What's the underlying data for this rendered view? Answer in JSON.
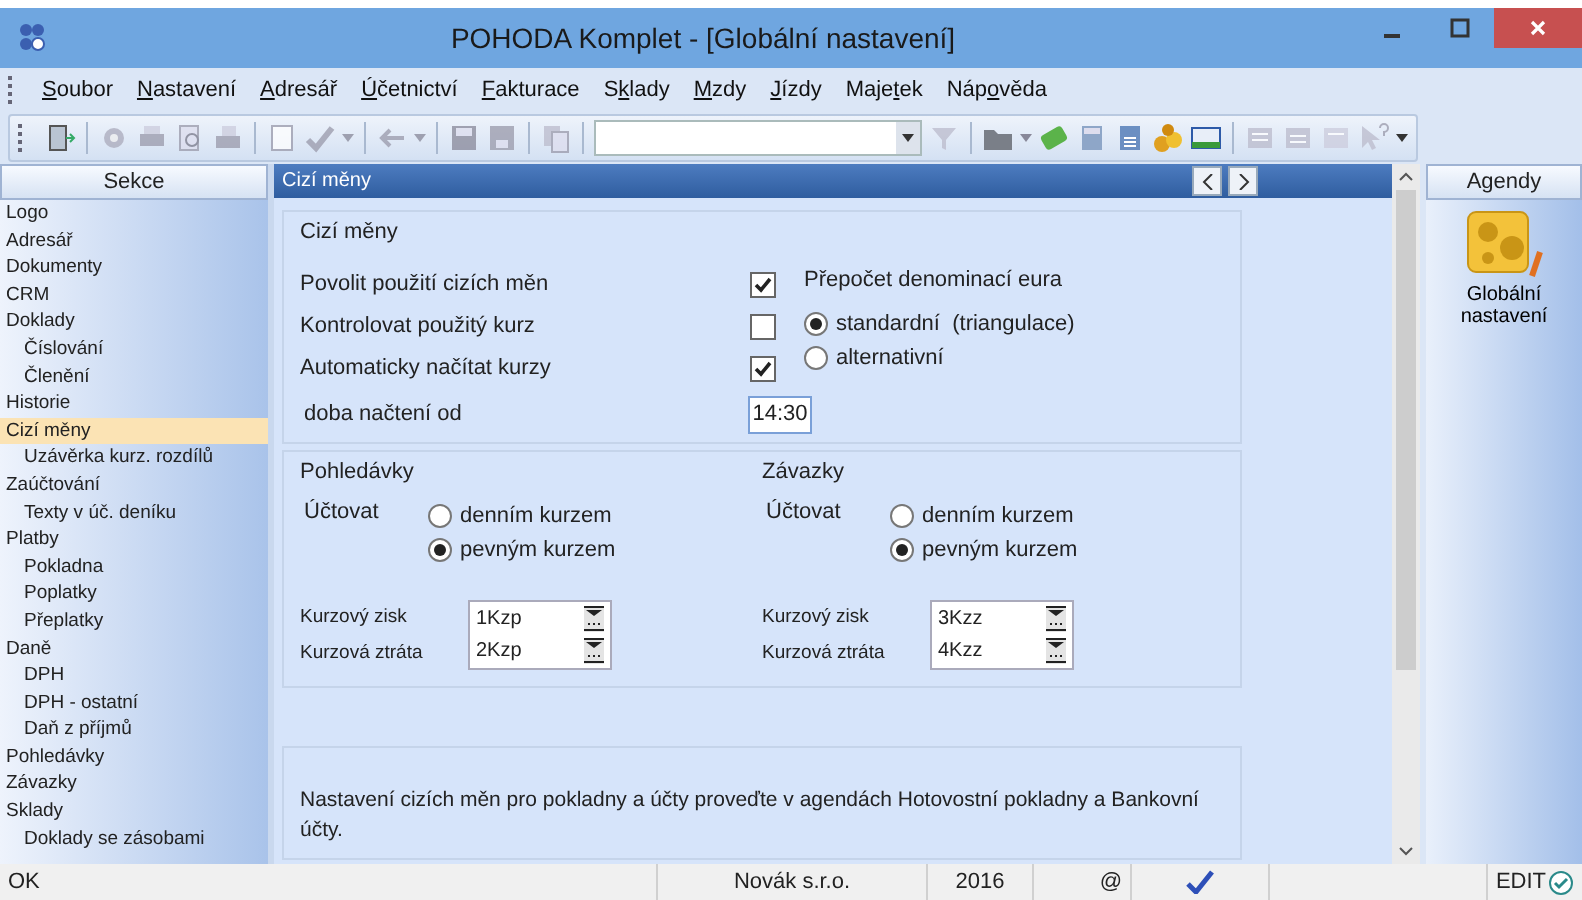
{
  "window": {
    "title": "POHODA Komplet - [Globální nastavení]"
  },
  "menu": [
    {
      "key": "S",
      "post": "oubor"
    },
    {
      "key": "N",
      "post": "astavení"
    },
    {
      "key": "A",
      "post": "dresář"
    },
    {
      "key": "Ú",
      "post": "četnictví"
    },
    {
      "key": "F",
      "post": "akturace"
    },
    {
      "pre": "S",
      "key": "k",
      "post": "lady"
    },
    {
      "key": "M",
      "post": "zdy"
    },
    {
      "key": "J",
      "post": "ízdy"
    },
    {
      "pre": "Maje",
      "key": "t",
      "post": "ek"
    },
    {
      "pre": "Náp",
      "key": "o",
      "post": "věda"
    }
  ],
  "sidebar": {
    "title": "Sekce",
    "items": [
      {
        "label": "Logo",
        "selected": false
      },
      {
        "label": "Adresář",
        "selected": false
      },
      {
        "label": "Dokumenty",
        "selected": false
      },
      {
        "label": "CRM",
        "selected": false
      },
      {
        "label": "Doklady",
        "selected": false,
        "children": [
          {
            "label": "Číslování",
            "selected": false
          },
          {
            "label": "Členění",
            "selected": false
          }
        ]
      },
      {
        "label": "Historie",
        "selected": false
      },
      {
        "label": "Cizí měny",
        "selected": true,
        "children": [
          {
            "label": "Uzávěrka kurz. rozdílů",
            "selected": false
          }
        ]
      },
      {
        "label": "Zaúčtování",
        "selected": false,
        "children": [
          {
            "label": "Texty v úč. deníku",
            "selected": false
          }
        ]
      },
      {
        "label": "Platby",
        "selected": false,
        "children": [
          {
            "label": "Pokladna",
            "selected": false
          },
          {
            "label": "Poplatky",
            "selected": false
          },
          {
            "label": "Přeplatky",
            "selected": false
          }
        ]
      },
      {
        "label": "Daně",
        "selected": false,
        "children": [
          {
            "label": "DPH",
            "selected": false
          },
          {
            "label": "DPH - ostatní",
            "selected": false
          },
          {
            "label": "Daň z příjmů",
            "selected": false
          }
        ]
      },
      {
        "label": "Pohledávky",
        "selected": false
      },
      {
        "label": "Závazky",
        "selected": false
      },
      {
        "label": "Sklady",
        "selected": false,
        "children": [
          {
            "label": "Doklady se zásobami",
            "selected": false
          }
        ]
      }
    ]
  },
  "panel": {
    "title": "Cizí měny",
    "group": {
      "title": "Cizí měny",
      "options": [
        {
          "label": "Povolit použití cizích měn",
          "checked": true
        },
        {
          "label": "Kontrolovat použitý kurz",
          "checked": false
        },
        {
          "label": "Automaticky načítat kurzy",
          "checked": true
        }
      ],
      "time": {
        "label": "doba načtení od",
        "value": "14:30"
      },
      "euro": {
        "title": "Přepočet denominací eura",
        "options": [
          {
            "label": "standardní  (triangulace)",
            "selected": true
          },
          {
            "label": "alternativní",
            "selected": false
          }
        ]
      }
    },
    "sections": [
      {
        "title": "Pohledávky",
        "label": "Účtovat",
        "options": [
          {
            "label": "denním kurzem",
            "selected": false
          },
          {
            "label": "pevným kurzem",
            "selected": true
          }
        ],
        "accounts": [
          {
            "label": "Kurzový zisk",
            "value": "1Kzp"
          },
          {
            "label": "Kurzová ztráta",
            "value": "2Kzp"
          }
        ]
      },
      {
        "title": "Závazky",
        "label": "Účtovat",
        "options": [
          {
            "label": "denním kurzem",
            "selected": false
          },
          {
            "label": "pevným kurzem",
            "selected": true
          }
        ],
        "accounts": [
          {
            "label": "Kurzový zisk",
            "value": "3Kzz"
          },
          {
            "label": "Kurzová ztráta",
            "value": "4Kzz"
          }
        ]
      }
    ],
    "note": "Nastavení cizích měn pro pokladny a účty proveďte v agendách Hotovostní pokladny a Bankovní účty."
  },
  "agendy": {
    "title": "Agendy",
    "item": "Globální nastavení"
  },
  "status_bar": {
    "message": "OK",
    "company": "Novák s.r.o.",
    "year": "2016",
    "at": "@",
    "mode": "EDIT"
  }
}
